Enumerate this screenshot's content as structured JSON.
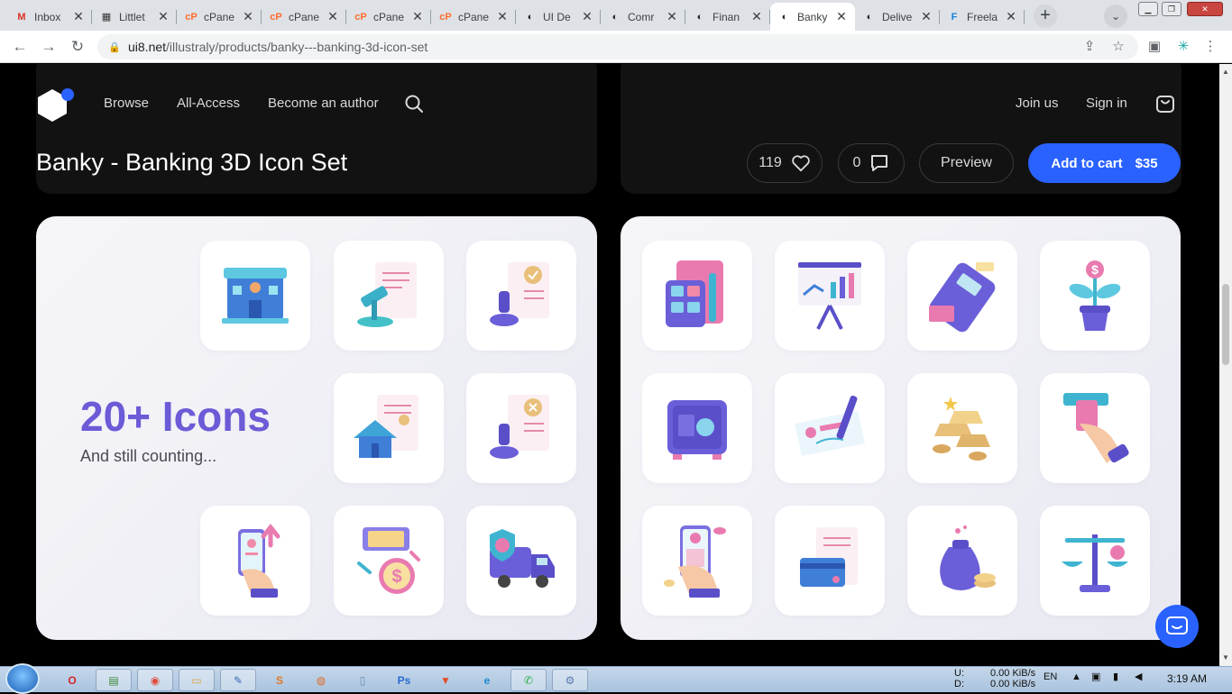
{
  "browser": {
    "tabs": [
      {
        "label": "Inbox",
        "icon": "gmail-icon",
        "color": "#d93025",
        "glyph": "M"
      },
      {
        "label": "Littlet",
        "icon": "film-icon",
        "color": "#333333",
        "glyph": "▦"
      },
      {
        "label": "cPane",
        "icon": "cpanel-icon",
        "color": "#ff6c2c",
        "glyph": "cP"
      },
      {
        "label": "cPane",
        "icon": "cpanel-icon",
        "color": "#ff6c2c",
        "glyph": "cP"
      },
      {
        "label": "cPane",
        "icon": "cpanel-icon",
        "color": "#ff6c2c",
        "glyph": "cP"
      },
      {
        "label": "cPane",
        "icon": "cpanel-icon",
        "color": "#ff6c2c",
        "glyph": "cP"
      },
      {
        "label": "UI De",
        "icon": "ui8-icon",
        "color": "#202124",
        "glyph": "◐"
      },
      {
        "label": "Comr",
        "icon": "ui8-icon",
        "color": "#202124",
        "glyph": "◐"
      },
      {
        "label": "Finan",
        "icon": "ui8-icon",
        "color": "#202124",
        "glyph": "◐"
      },
      {
        "label": "Banky",
        "icon": "ui8-icon",
        "color": "#202124",
        "glyph": "◐",
        "active": true
      },
      {
        "label": "Delive",
        "icon": "ui8-icon",
        "color": "#202124",
        "glyph": "◐"
      },
      {
        "label": "Freela",
        "icon": "freelancer-icon",
        "color": "#1a7fd4",
        "glyph": "F"
      }
    ],
    "close_glyph": "✕",
    "new_tab_glyph": "+",
    "tab_search_glyph": "⌄",
    "url_host": "ui8.net",
    "url_path": "/illustraly/products/banky---banking-3d-icon-set",
    "back_glyph": "←",
    "forward_glyph": "→",
    "reload_glyph": "↻",
    "lock_glyph": "🔒",
    "share_glyph": "⇪",
    "star_glyph": "☆",
    "sidepanel_glyph": "▣",
    "extension_glyph": "✳",
    "menu_glyph": "⋮",
    "win_min": "▁",
    "win_max": "❐",
    "win_close": "✕"
  },
  "site": {
    "nav": {
      "browse": "Browse",
      "all_access": "All-Access",
      "become_author": "Become an author"
    },
    "join": "Join us",
    "signin": "Sign in"
  },
  "product": {
    "title": "Banky - Banking 3D Icon Set",
    "likes": "119",
    "comments": "0",
    "preview": "Preview",
    "add_to_cart": "Add to cart",
    "price": "$35"
  },
  "preview_left": {
    "headline": "20+ Icons",
    "subline": "And still counting..."
  },
  "colors": {
    "accent": "#2a62ff",
    "headline": "#6b5bd6"
  },
  "taskbar": {
    "net_up_label": "U:",
    "net_down_label": "D:",
    "net_up": "0.00 KiB/s",
    "net_down": "0.00 KiB/s",
    "lang": "EN",
    "time": "3:19 AM"
  },
  "taskbar_apps": [
    "opera-icon",
    "explorer-icon",
    "chrome-icon",
    "folder-icon",
    "notepad-icon",
    "sublime-icon",
    "firefox-icon",
    "notes-icon",
    "photoshop-icon",
    "brave-icon",
    "edge-icon",
    "whatsapp-icon",
    "network-icon"
  ]
}
